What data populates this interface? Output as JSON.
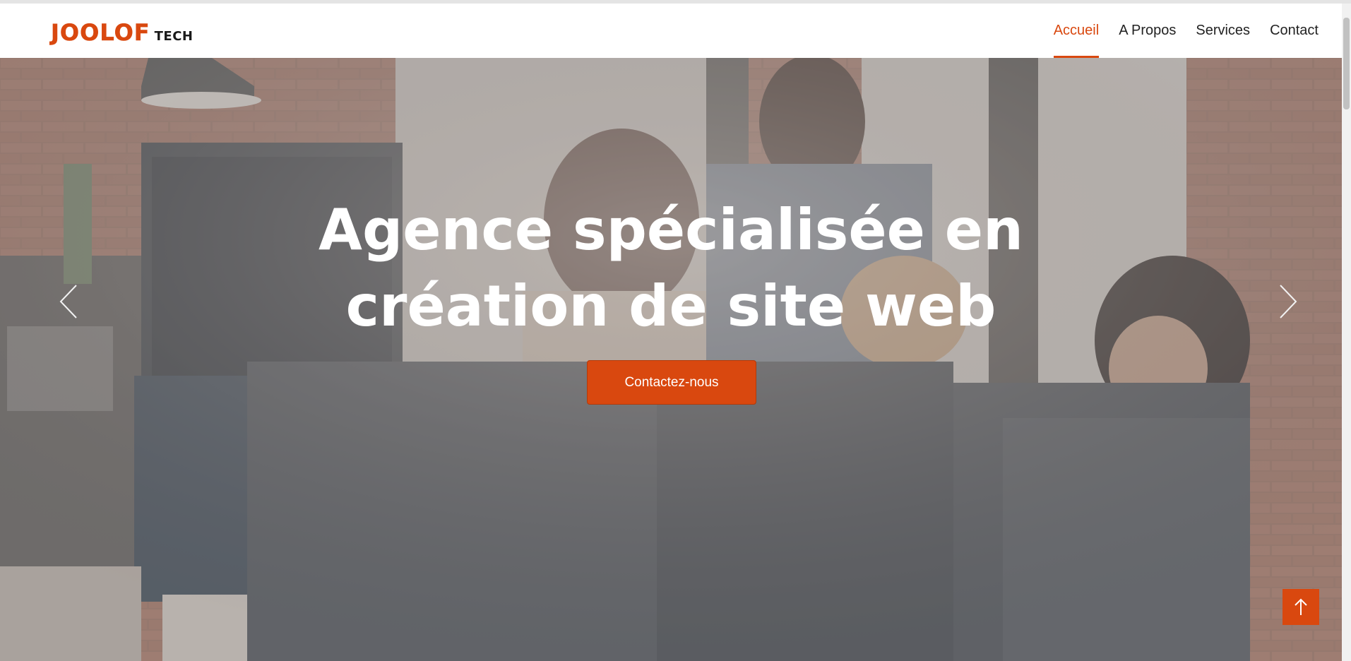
{
  "brand": {
    "logo_main": "JOOLOF",
    "logo_sub": "TECH",
    "accent_color": "#d9480f"
  },
  "nav": {
    "items": [
      {
        "label": "Accueil",
        "active": true
      },
      {
        "label": "A Propos",
        "active": false
      },
      {
        "label": "Services",
        "active": false
      },
      {
        "label": "Contact",
        "active": false
      }
    ]
  },
  "hero": {
    "title_line1": "Agence spécialisée en",
    "title_line2": "création de site web",
    "cta_label": "Contactez-nous",
    "prev_icon": "chevron-left-icon",
    "next_icon": "chevron-right-icon"
  },
  "back_to_top": {
    "icon": "arrow-up-icon"
  }
}
